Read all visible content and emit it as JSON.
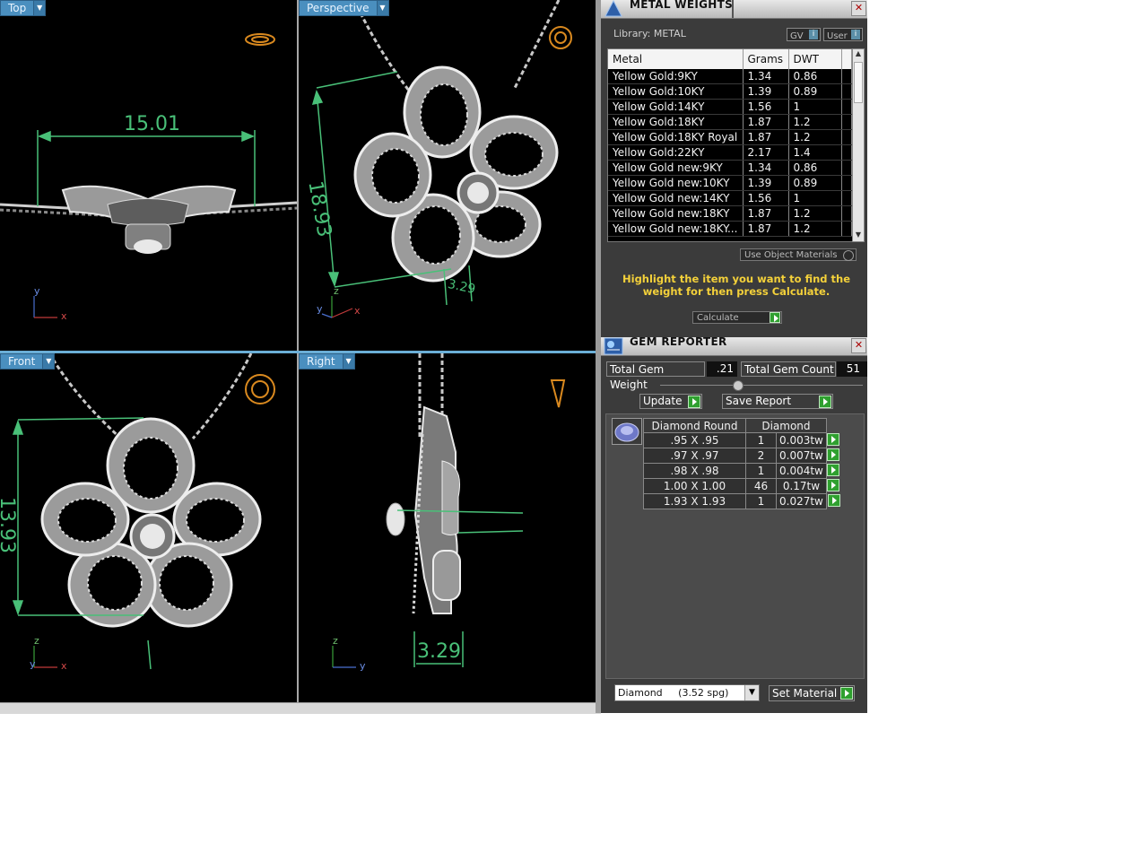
{
  "viewports": {
    "top": {
      "label": "Top",
      "dimension": "15.01",
      "axes": [
        "y",
        "x"
      ]
    },
    "perspective": {
      "label": "Perspective",
      "dim_a": "18.93",
      "dim_b": "3.29",
      "axes": [
        "z",
        "y",
        "x"
      ]
    },
    "front": {
      "label": "Front",
      "dimension": "13.93",
      "axes": [
        "z",
        "y",
        "x"
      ]
    },
    "right": {
      "label": "Right",
      "dimension": "3.29",
      "axes": [
        "z",
        "y"
      ]
    }
  },
  "metal_weights": {
    "title": "METAL WEIGHTS",
    "library_label": "Library: METAL",
    "gv_label": "GV",
    "user_label": "User",
    "columns": [
      "Metal",
      "Grams",
      "DWT"
    ],
    "rows": [
      {
        "metal": "Yellow Gold:9KY",
        "grams": "1.34",
        "dwt": "0.86"
      },
      {
        "metal": "Yellow Gold:10KY",
        "grams": "1.39",
        "dwt": "0.89"
      },
      {
        "metal": "Yellow Gold:14KY",
        "grams": "1.56",
        "dwt": "1"
      },
      {
        "metal": "Yellow Gold:18KY",
        "grams": "1.87",
        "dwt": "1.2"
      },
      {
        "metal": "Yellow Gold:18KY Royal",
        "grams": "1.87",
        "dwt": "1.2"
      },
      {
        "metal": "Yellow Gold:22KY",
        "grams": "2.17",
        "dwt": "1.4"
      },
      {
        "metal": "Yellow Gold new:9KY",
        "grams": "1.34",
        "dwt": "0.86"
      },
      {
        "metal": "Yellow Gold new:10KY",
        "grams": "1.39",
        "dwt": "0.89"
      },
      {
        "metal": "Yellow Gold new:14KY",
        "grams": "1.56",
        "dwt": "1"
      },
      {
        "metal": "Yellow Gold new:18KY",
        "grams": "1.87",
        "dwt": "1.2"
      },
      {
        "metal": "Yellow Gold new:18KY...",
        "grams": "1.87",
        "dwt": "1.2"
      }
    ],
    "use_object_materials": "Use Object Materials",
    "hint": "Highlight the item you want to find the weight for then press Calculate.",
    "calculate_label": "Calculate"
  },
  "gem_reporter": {
    "title": "GEM REPORTER",
    "total_weight_label": "Total Gem Weight",
    "total_weight_value": ".21",
    "total_count_label": "Total Gem Count",
    "total_count_value": "51",
    "update_label": "Update",
    "save_report_label": "Save Report",
    "header_shape": "Diamond Round",
    "header_type": "Diamond",
    "rows": [
      {
        "size": ".95 X .95",
        "count": "1",
        "tw": "0.003tw"
      },
      {
        "size": ".97 X .97",
        "count": "2",
        "tw": "0.007tw"
      },
      {
        "size": ".98 X .98",
        "count": "1",
        "tw": "0.004tw"
      },
      {
        "size": "1.00 X 1.00",
        "count": "46",
        "tw": "0.17tw"
      },
      {
        "size": "1.93 X 1.93",
        "count": "1",
        "tw": "0.027tw"
      }
    ],
    "material_select": "Diamond     (3.52 spg)",
    "set_material_label": "Set Material"
  },
  "colors": {
    "viewport_bg": "#000000",
    "dimension": "#49c078",
    "panel_bg": "#3b3b3b",
    "accent_yellow": "#f4d13a",
    "tab_blue": "#4a8fbf"
  }
}
